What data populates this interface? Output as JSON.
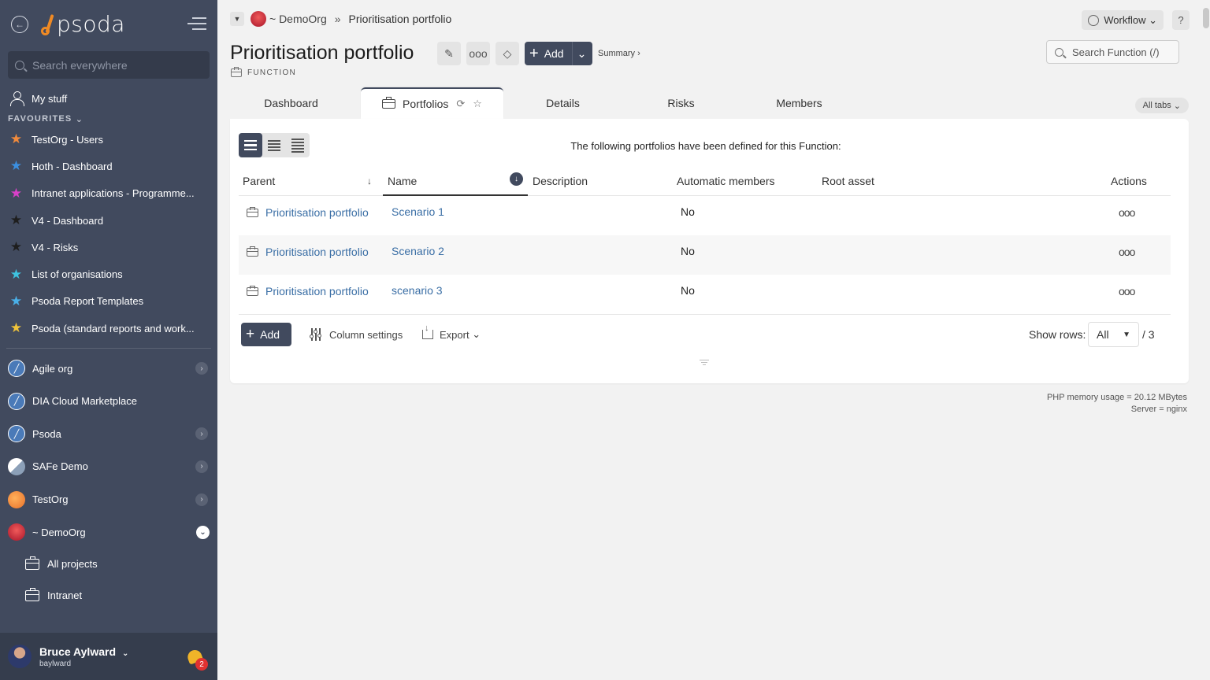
{
  "sidebar": {
    "logo": "psoda",
    "search_placeholder": "Search everywhere",
    "mystuff": "My stuff",
    "favourites_label": "FAVOURITES",
    "favourites": [
      {
        "label": "TestOrg - Users",
        "color": "#f08a3c"
      },
      {
        "label": "Hoth - Dashboard",
        "color": "#3b8fe0"
      },
      {
        "label": "Intranet applications - Programme...",
        "color": "#d840c8"
      },
      {
        "label": "V4 - Dashboard",
        "color": "#1e1e1e"
      },
      {
        "label": "V4 - Risks",
        "color": "#1e1e1e"
      },
      {
        "label": "List of organisations",
        "color": "#3ec3e0"
      },
      {
        "label": "Psoda Report Templates",
        "color": "#4ab0e8"
      },
      {
        "label": "Psoda (standard reports and work...",
        "color": "#f0c43a"
      }
    ],
    "orgs": [
      {
        "label": "Agile org",
        "icon": "agile",
        "chevron": "right"
      },
      {
        "label": "DIA Cloud Marketplace",
        "icon": "agile",
        "chevron": ""
      },
      {
        "label": "Psoda",
        "icon": "agile",
        "chevron": "right"
      },
      {
        "label": "SAFe Demo",
        "icon": "safe",
        "chevron": "right"
      },
      {
        "label": "TestOrg",
        "icon": "test",
        "chevron": "right"
      },
      {
        "label": "~ DemoOrg",
        "icon": "demo",
        "chevron": "down"
      }
    ],
    "sub_items": [
      "All projects",
      "Intranet"
    ],
    "user": {
      "name": "Bruce Aylward",
      "handle": "baylward",
      "notifications": "2"
    }
  },
  "breadcrumb": {
    "org": "~ DemoOrg",
    "separator": "»",
    "current": "Prioritisation portfolio"
  },
  "header": {
    "title": "Prioritisation portfolio",
    "type": "FUNCTION",
    "add_label": "Add",
    "summary_label": "Summary ›",
    "workflow_label": "Workflow",
    "help_label": "?",
    "search_placeholder": "Search Function (/)"
  },
  "tabs": {
    "items": [
      "Dashboard",
      "Portfolios",
      "Details",
      "Risks",
      "Members"
    ],
    "active": "Portfolios",
    "all_tabs": "All tabs"
  },
  "panel": {
    "intro": "The following portfolios have been defined for this Function:",
    "columns": [
      "Parent",
      "Name",
      "Description",
      "Automatic members",
      "Root asset",
      "Actions"
    ],
    "rows": [
      {
        "parent": "Prioritisation portfolio",
        "name": "Scenario 1",
        "description": "",
        "automatic": "No",
        "root": ""
      },
      {
        "parent": "Prioritisation portfolio",
        "name": "Scenario 2",
        "description": "",
        "automatic": "No",
        "root": ""
      },
      {
        "parent": "Prioritisation portfolio",
        "name": "scenario 3",
        "description": "",
        "automatic": "No",
        "root": ""
      }
    ],
    "add_label": "Add",
    "column_settings": "Column settings",
    "export_label": "Export",
    "show_rows_label": "Show rows:",
    "rows_value": "All",
    "rows_total": "/ 3"
  },
  "footer": {
    "memory": "PHP memory usage = 20.12 MBytes",
    "server": "Server = nginx"
  }
}
